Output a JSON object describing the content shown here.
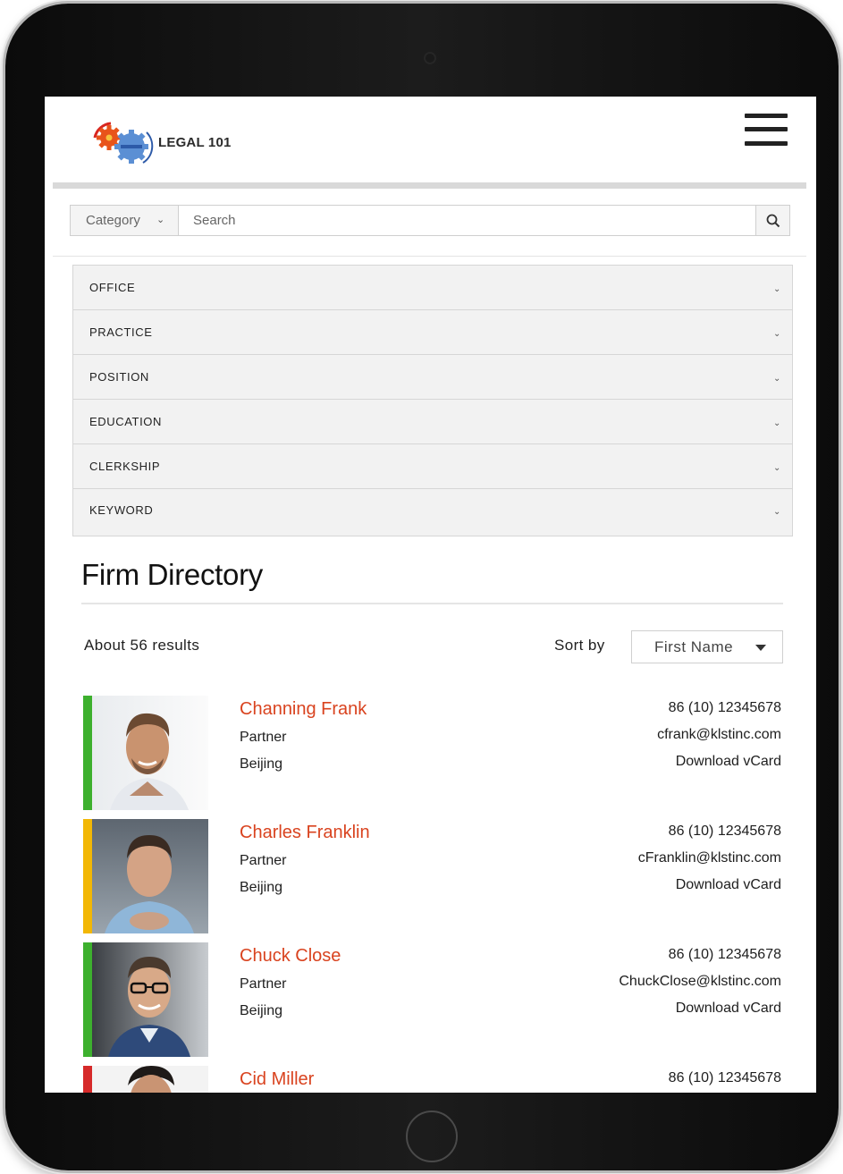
{
  "brand": {
    "name": "LEGAL 101"
  },
  "search": {
    "category_label": "Category",
    "placeholder": "Search"
  },
  "filters": [
    "OFFICE",
    "PRACTICE",
    "POSITION",
    "EDUCATION",
    "CLERKSHIP",
    "KEYWORD"
  ],
  "directory": {
    "title": "Firm Directory",
    "results_count": "About 56 results",
    "sort_label": "Sort by",
    "sort_value": "First Name"
  },
  "people": [
    {
      "name": "Channing Frank",
      "title": "Partner",
      "office": "Beijing",
      "phone": "86 (10) 12345678",
      "email": "cfrank@klstinc.com",
      "vcard": "Download vCard",
      "accent_color": "#3db02e"
    },
    {
      "name": "Charles Franklin",
      "title": "Partner",
      "office": "Beijing",
      "phone": "86 (10) 12345678",
      "email": "cFranklin@klstinc.com",
      "vcard": "Download vCard",
      "accent_color": "#f2b705"
    },
    {
      "name": "Chuck Close",
      "title": "Partner",
      "office": "Beijing",
      "phone": "86 (10) 12345678",
      "email": "ChuckClose@klstinc.com",
      "vcard": "Download vCard",
      "accent_color": "#3db02e"
    },
    {
      "name": "Cid Miller",
      "phone": "86 (10) 12345678",
      "accent_color": "#d62a2a"
    }
  ],
  "colors": {
    "name_link": "#d9431f",
    "filter_bg": "#f2f2f2",
    "header_bar": "#d9d9d9"
  }
}
